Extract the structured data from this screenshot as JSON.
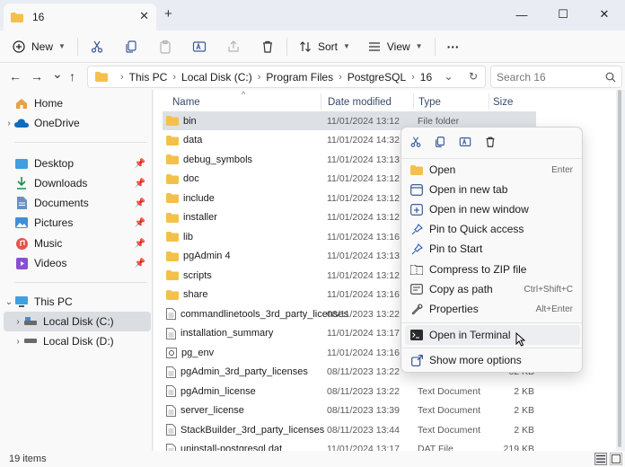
{
  "window": {
    "tab_title": "16",
    "tab_close": "✕",
    "new_tab": "+",
    "minimize": "—",
    "maximize": "☐",
    "close": "✕"
  },
  "toolbar": {
    "new_label": "New",
    "sort_label": "Sort",
    "view_label": "View",
    "more": "···"
  },
  "nav": {
    "back": "←",
    "forward": "→",
    "recent": "⌄",
    "up": "↑"
  },
  "address": {
    "crumbs": [
      "This PC",
      "Local Disk (C:)",
      "Program Files",
      "PostgreSQL",
      "16"
    ],
    "dropdown": "⌄",
    "refresh": "↻"
  },
  "search": {
    "placeholder": "Search 16"
  },
  "sidebar": {
    "home": "Home",
    "onedrive": "OneDrive",
    "desktop": "Desktop",
    "downloads": "Downloads",
    "documents": "Documents",
    "pictures": "Pictures",
    "music": "Music",
    "videos": "Videos",
    "thispc": "This PC",
    "localc": "Local Disk (C:)",
    "locald": "Local Disk (D:)"
  },
  "columns": {
    "name": "Name",
    "date": "Date modified",
    "type": "Type",
    "size": "Size"
  },
  "files": [
    {
      "name": "bin",
      "date": "11/01/2024 13:12",
      "type": "File folder",
      "size": "",
      "kind": "folder"
    },
    {
      "name": "data",
      "date": "11/01/2024 14:32",
      "type": "",
      "size": "",
      "kind": "folder"
    },
    {
      "name": "debug_symbols",
      "date": "11/01/2024 13:13",
      "type": "",
      "size": "",
      "kind": "folder"
    },
    {
      "name": "doc",
      "date": "11/01/2024 13:12",
      "type": "",
      "size": "",
      "kind": "folder"
    },
    {
      "name": "include",
      "date": "11/01/2024 13:12",
      "type": "",
      "size": "",
      "kind": "folder"
    },
    {
      "name": "installer",
      "date": "11/01/2024 13:12",
      "type": "",
      "size": "",
      "kind": "folder"
    },
    {
      "name": "lib",
      "date": "11/01/2024 13:16",
      "type": "",
      "size": "",
      "kind": "folder"
    },
    {
      "name": "pgAdmin 4",
      "date": "11/01/2024 13:13",
      "type": "",
      "size": "",
      "kind": "folder"
    },
    {
      "name": "scripts",
      "date": "11/01/2024 13:12",
      "type": "",
      "size": "",
      "kind": "folder"
    },
    {
      "name": "share",
      "date": "11/01/2024 13:16",
      "type": "",
      "size": "",
      "kind": "folder"
    },
    {
      "name": "commandlinetools_3rd_party_licenses",
      "date": "08/11/2023 13:22",
      "type": "",
      "size": "",
      "kind": "doc"
    },
    {
      "name": "installation_summary",
      "date": "11/01/2024 13:17",
      "type": "",
      "size": "",
      "kind": "doc"
    },
    {
      "name": "pg_env",
      "date": "11/01/2024 13:16",
      "type": "",
      "size": "",
      "kind": "bat"
    },
    {
      "name": "pgAdmin_3rd_party_licenses",
      "date": "08/11/2023 13:22",
      "type": "",
      "size": "62 KB",
      "kind": "doc"
    },
    {
      "name": "pgAdmin_license",
      "date": "08/11/2023 13:22",
      "type": "Text Document",
      "size": "2 KB",
      "kind": "doc"
    },
    {
      "name": "server_license",
      "date": "08/11/2023 13:39",
      "type": "Text Document",
      "size": "2 KB",
      "kind": "doc"
    },
    {
      "name": "StackBuilder_3rd_party_licenses",
      "date": "08/11/2023 13:44",
      "type": "Text Document",
      "size": "2 KB",
      "kind": "doc"
    },
    {
      "name": "uninstall-postgresql.dat",
      "date": "11/01/2024 13:17",
      "type": "DAT File",
      "size": "219 KB",
      "kind": "doc"
    }
  ],
  "context_menu": {
    "items": [
      {
        "label": "Open",
        "shortcut": "Enter",
        "icon": "folder-open-icon"
      },
      {
        "label": "Open in new tab",
        "shortcut": "",
        "icon": "new-tab-icon"
      },
      {
        "label": "Open in new window",
        "shortcut": "",
        "icon": "new-window-icon"
      },
      {
        "label": "Pin to Quick access",
        "shortcut": "",
        "icon": "pin-icon"
      },
      {
        "label": "Pin to Start",
        "shortcut": "",
        "icon": "pin-start-icon"
      },
      {
        "label": "Compress to ZIP file",
        "shortcut": "",
        "icon": "zip-icon"
      },
      {
        "label": "Copy as path",
        "shortcut": "Ctrl+Shift+C",
        "icon": "copy-path-icon"
      },
      {
        "label": "Properties",
        "shortcut": "Alt+Enter",
        "icon": "wrench-icon"
      },
      {
        "label": "Open in Terminal",
        "shortcut": "",
        "icon": "terminal-icon"
      },
      {
        "label": "Show more options",
        "shortcut": "",
        "icon": "more-options-icon"
      }
    ]
  },
  "status": {
    "count": "19 items"
  },
  "colors": {
    "folder": "#f3c14a",
    "accent": "#0067c0",
    "selected": "#dde1e6"
  }
}
